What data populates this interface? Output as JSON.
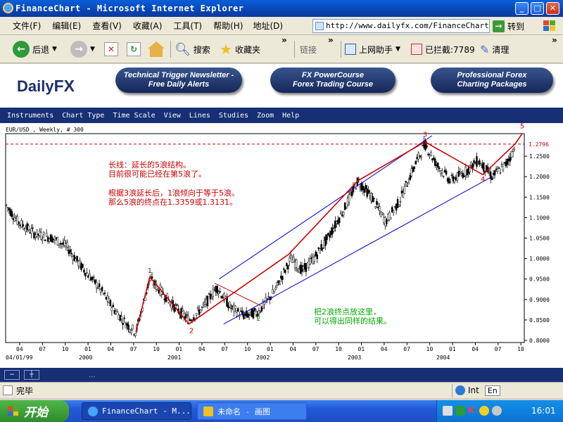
{
  "window": {
    "title": "FinanceChart - Microsoft Internet Explorer",
    "min": "_",
    "max": "□",
    "close": "✕"
  },
  "menu": [
    "文件(F)",
    "编辑(E)",
    "查看(V)",
    "收藏(A)",
    "工具(T)",
    "帮助(H)"
  ],
  "address": {
    "label": "地址(D)",
    "url": "http://www.dailyfx.com/FinanceChart.",
    "go": "转到"
  },
  "toolbar": {
    "back": "后退",
    "search": "搜索",
    "favorites": "收藏夹",
    "links": "链接",
    "helper": "上网助手",
    "blocked": "已拦截:7789",
    "clean": "清理"
  },
  "site": {
    "logo_daily": "Daily",
    "logo_fx": "FX",
    "banners": [
      {
        "line1": "Technical Trigger Newsletter -",
        "line2": "Free Daily Alerts"
      },
      {
        "line1": "FX PowerCourse",
        "line2": "Forex Trading Course"
      },
      {
        "line1": "Professional Forex",
        "line2": "Charting Packages"
      }
    ],
    "nav": [
      "Instruments",
      "Chart Type",
      "Time Scale",
      "View",
      "Lines",
      "Studies",
      "Zoom",
      "Help"
    ]
  },
  "chart_data": {
    "type": "candlestick",
    "title": "EUR/USD , Weekly, # 300",
    "price_label": "1.2796",
    "y_ticks": [
      "1.2500",
      "1.2000",
      "1.1500",
      "1.1000",
      "1.0500",
      "1.0000",
      "0.9500",
      "0.9000",
      "0.8500",
      "0.8000"
    ],
    "ylim": [
      0.8,
      1.3
    ],
    "x_month_ticks": [
      "04",
      "07",
      "10",
      "01",
      "04",
      "07",
      "10",
      "01",
      "04",
      "07",
      "10",
      "01",
      "04",
      "07",
      "10",
      "01",
      "04",
      "07",
      "10",
      "01",
      "04",
      "07",
      "10"
    ],
    "x_year_labels": [
      "04/01/99",
      "2000",
      "2001",
      "2002",
      "2003",
      "2004"
    ],
    "wave_labels": [
      "1",
      "2",
      "3",
      "4",
      "5",
      "2"
    ],
    "annotations": {
      "top_note": [
        "长线：延长的5浪结构。",
        "目前很可能已经在第5浪了。"
      ],
      "mid_note": [
        "根据3浪延长后，1浪倾向于等于5浪。",
        "那么5浪的终点在1.3359或1.3131。"
      ],
      "green_note": [
        "把2浪终点放这里，",
        "可以得出同样的结果。"
      ]
    },
    "colors": {
      "candles": "#000000",
      "waves": "#cc0000",
      "channel": "#0000cc",
      "dashed": "#cc0000",
      "green_note": "#00aa00"
    }
  },
  "status": {
    "text": "完毕",
    "zone": "Int"
  },
  "taskbar": {
    "start": "开始",
    "tasks": [
      "FinanceChart - M...",
      "未命名 - 画图"
    ],
    "clock": "16:01",
    "lang": "En"
  }
}
